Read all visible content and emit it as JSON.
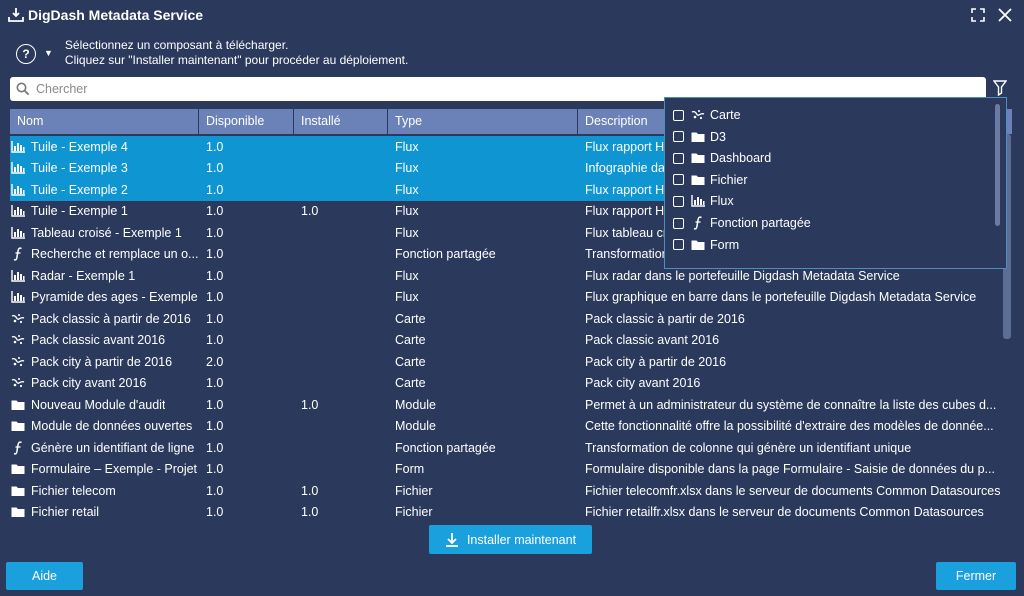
{
  "window": {
    "title": "DigDash Metadata Service",
    "app_icon": "download-tray-icon"
  },
  "help": {
    "line1": "Sélectionnez un composant à télécharger.",
    "line2": "Cliquez sur \"Installer maintenant\" pour procéder au déploiement."
  },
  "search": {
    "placeholder": "Chercher",
    "value": ""
  },
  "table": {
    "columns": [
      "Nom",
      "Disponible",
      "Installé",
      "Type",
      "Description"
    ],
    "rows": [
      {
        "icon": "chart-icon",
        "nom": "Tuile - Exemple 4",
        "dispo": "1.0",
        "inst": "",
        "type": "Flux",
        "desc": "Flux rapport HTML dans le portefeuille Digdash Metadata Service",
        "selected": true
      },
      {
        "icon": "chart-icon",
        "nom": "Tuile - Exemple 3",
        "dispo": "1.0",
        "inst": "",
        "type": "Flux",
        "desc": "Infographie dans le portefeuille Digdash Metadata Service",
        "selected": true
      },
      {
        "icon": "chart-icon",
        "nom": "Tuile - Exemple 2",
        "dispo": "1.0",
        "inst": "",
        "type": "Flux",
        "desc": "Flux rapport HTML dans le portefeuille Digdash Metadata Service",
        "selected": true
      },
      {
        "icon": "chart-icon",
        "nom": "Tuile - Exemple 1",
        "dispo": "1.0",
        "inst": "1.0",
        "type": "Flux",
        "desc": "Flux rapport HTML dans le portefeuille Digdash Metadata Service",
        "selected": false
      },
      {
        "icon": "chart-icon",
        "nom": "Tableau croisé - Exemple 1",
        "dispo": "1.0",
        "inst": "",
        "type": "Flux",
        "desc": "Flux tableau croisé dans le portefeuille Digdash Metadata Service",
        "selected": false
      },
      {
        "icon": "function-icon",
        "nom": "Recherche et remplace un o...",
        "dispo": "1.0",
        "inst": "",
        "type": "Fonction partagée",
        "desc": "Transformation de colonne",
        "selected": false
      },
      {
        "icon": "chart-icon",
        "nom": "Radar - Exemple 1",
        "dispo": "1.0",
        "inst": "",
        "type": "Flux",
        "desc": "Flux radar dans le portefeuille Digdash Metadata Service",
        "selected": false
      },
      {
        "icon": "chart-icon",
        "nom": "Pyramide des ages - Exemple",
        "dispo": "1.0",
        "inst": "",
        "type": "Flux",
        "desc": "Flux graphique en barre dans le portefeuille Digdash Metadata Service",
        "selected": false
      },
      {
        "icon": "map-icon",
        "nom": "Pack classic à partir de 2016",
        "dispo": "1.0",
        "inst": "",
        "type": "Carte",
        "desc": "Pack classic à partir de 2016",
        "selected": false
      },
      {
        "icon": "map-icon",
        "nom": "Pack classic avant 2016",
        "dispo": "1.0",
        "inst": "",
        "type": "Carte",
        "desc": "Pack classic avant 2016",
        "selected": false
      },
      {
        "icon": "map-icon",
        "nom": "Pack city à partir de 2016",
        "dispo": "2.0",
        "inst": "",
        "type": "Carte",
        "desc": "Pack city à partir de 2016",
        "selected": false
      },
      {
        "icon": "map-icon",
        "nom": "Pack city avant 2016",
        "dispo": "1.0",
        "inst": "",
        "type": "Carte",
        "desc": "Pack city avant 2016",
        "selected": false
      },
      {
        "icon": "folder-icon",
        "nom": "Nouveau Module d'audit",
        "dispo": "1.0",
        "inst": "1.0",
        "type": "Module",
        "desc": "Permet à un administrateur du système de connaître la liste des cubes d...",
        "selected": false
      },
      {
        "icon": "folder-icon",
        "nom": "Module de données ouvertes",
        "dispo": "1.0",
        "inst": "",
        "type": "Module",
        "desc": "Cette fonctionnalité offre la possibilité d'extraire des modèles de donnée...",
        "selected": false
      },
      {
        "icon": "function-icon",
        "nom": "Génère un identifiant de ligne",
        "dispo": "1.0",
        "inst": "",
        "type": "Fonction partagée",
        "desc": "Transformation de colonne qui génère un identifiant unique",
        "selected": false
      },
      {
        "icon": "folder-icon",
        "nom": "Formulaire – Exemple - Projet",
        "dispo": "1.0",
        "inst": "",
        "type": "Form",
        "desc": "Formulaire disponible dans la page  Formulaire - Saisie de données du  p...",
        "selected": false
      },
      {
        "icon": "folder-icon",
        "nom": "Fichier telecom",
        "dispo": "1.0",
        "inst": "1.0",
        "type": "Fichier",
        "desc": "Fichier telecomfr.xlsx dans le serveur de documents Common Datasources",
        "selected": false
      },
      {
        "icon": "folder-icon",
        "nom": "Fichier retail",
        "dispo": "1.0",
        "inst": "1.0",
        "type": "Fichier",
        "desc": "Fichier retailfr.xlsx dans le serveur de documents Common Datasources",
        "selected": false
      }
    ]
  },
  "type_filter": {
    "items": [
      {
        "icon": "map-icon",
        "label": "Carte",
        "checked": false
      },
      {
        "icon": "folder-icon",
        "label": "D3",
        "checked": false
      },
      {
        "icon": "folder-icon",
        "label": "Dashboard",
        "checked": false
      },
      {
        "icon": "folder-icon",
        "label": "Fichier",
        "checked": false
      },
      {
        "icon": "chart-icon",
        "label": "Flux",
        "checked": false
      },
      {
        "icon": "function-icon",
        "label": "Fonction partagée",
        "checked": false
      },
      {
        "icon": "folder-icon",
        "label": "Form",
        "checked": false
      }
    ]
  },
  "buttons": {
    "install": "Installer maintenant",
    "help": "Aide",
    "close": "Fermer"
  },
  "colors": {
    "background": "#2b3a5c",
    "header": "#6a82b8",
    "selected_row": "#0f96d2",
    "button": "#1ba0de"
  }
}
